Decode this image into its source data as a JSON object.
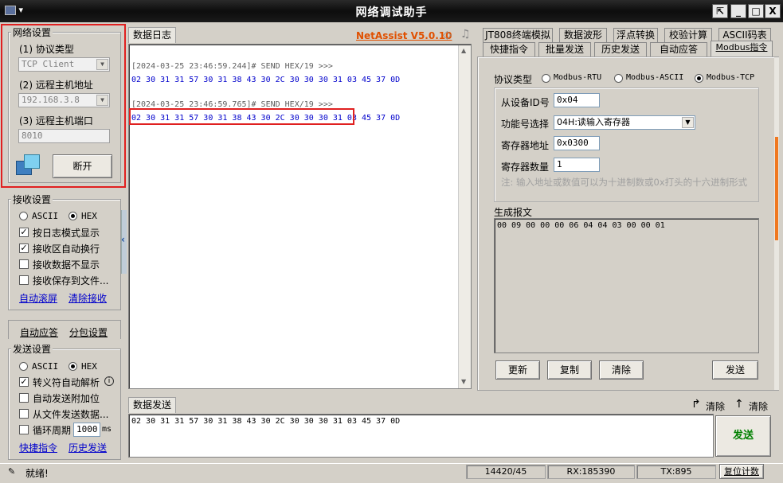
{
  "window": {
    "title": "网络调试助手",
    "buttons": {
      "pin": "⇱",
      "minimize": "_",
      "maximize": "□",
      "close": "X"
    }
  },
  "network": {
    "group_title": "网络设置",
    "protocol_label": "(1) 协议类型",
    "protocol_value": "TCP Client",
    "host_label": "(2) 远程主机地址",
    "host_value": "192.168.3.8",
    "port_label": "(3) 远程主机端口",
    "port_value": "8010",
    "disconnect_label": "断开"
  },
  "receive": {
    "group_title": "接收设置",
    "mode_ascii": "ASCII",
    "mode_hex": "HEX",
    "mode_selected": "HEX",
    "options": [
      {
        "label": "按日志模式显示",
        "checked": true
      },
      {
        "label": "接收区自动换行",
        "checked": true
      },
      {
        "label": "接收数据不显示",
        "checked": false
      },
      {
        "label": "接收保存到文件...",
        "checked": false
      }
    ],
    "auto_scroll_link": "自动滚屏",
    "clear_link": "清除接收"
  },
  "middle_tabs": {
    "auto_reply": "自动应答",
    "packet_settings": "分包设置"
  },
  "send": {
    "group_title": "发送设置",
    "mode_ascii": "ASCII",
    "mode_hex": "HEX",
    "options": [
      {
        "label": "转义符自动解析",
        "checked": true
      },
      {
        "label": "自动发送附加位",
        "checked": false
      },
      {
        "label": "从文件发送数据...",
        "checked": false
      },
      {
        "label": "循环周期",
        "checked": false
      }
    ],
    "cycle_value": "1000",
    "cycle_unit": "ms",
    "quick_cmd_link": "快捷指令",
    "history_link": "历史发送"
  },
  "log": {
    "tab_label": "数据日志",
    "brand": "NetAssist V5.0.10",
    "entries": [
      {
        "header": "[2024-03-25 23:46:59.244]# SEND HEX/19 >>>",
        "data": "02 30 31 31 57 30 31 38 43 30 2C 30 30 30 31 03 45 37 0D"
      },
      {
        "header": "[2024-03-25 23:46:59.765]# SEND HEX/19 >>>",
        "data": "02 30 31 31 57 30 31 38 43 30 2C 30 30 30 31 03 45 37 0D"
      }
    ]
  },
  "send_area": {
    "tab_label": "数据发送",
    "clear1": "清除",
    "clear2": "清除",
    "value": "02 30 31 31 57 30 31 38 43 30 2C 30 30 30 31 03 45 37 0D",
    "send_button": "发送"
  },
  "right_tabs": {
    "row1": [
      "JT808终端模拟",
      "数据波形",
      "浮点转换",
      "校验计算",
      "ASCII码表"
    ],
    "row2": [
      "快捷指令",
      "批量发送",
      "历史发送",
      "自动应答",
      "Modbus指令"
    ],
    "active": "Modbus指令"
  },
  "modbus": {
    "protocol_label": "协议类型",
    "protocol_options": [
      "Modbus-RTU",
      "Modbus-ASCII",
      "Modbus-TCP"
    ],
    "protocol_selected": "Modbus-TCP",
    "slave_id_label": "从设备ID号",
    "slave_id_value": "0x04",
    "function_label": "功能号选择",
    "function_value": "04H:读输入寄存器",
    "reg_addr_label": "寄存器地址",
    "reg_addr_value": "0x0300",
    "reg_count_label": "寄存器数量",
    "reg_count_value": "1",
    "note": "注: 输入地址或数值可以为十进制数或0x打头的十六进制形式",
    "generated_label": "生成报文",
    "generated_value": "00 09 00 00 00 06 04 04 03 00 00 01",
    "buttons": {
      "update": "更新",
      "copy": "复制",
      "clear": "清除",
      "send": "发送"
    }
  },
  "status": {
    "ready_text": "就绪!",
    "counter": "14420/45",
    "rx": "RX:185390",
    "tx": "TX:895",
    "reset_label": "复位计数"
  },
  "colors": {
    "brand": "#e05000",
    "log_header": "#606060",
    "log_data": "#0000cc",
    "highlight_box": "#e02020",
    "send_button_text": "#008000"
  }
}
